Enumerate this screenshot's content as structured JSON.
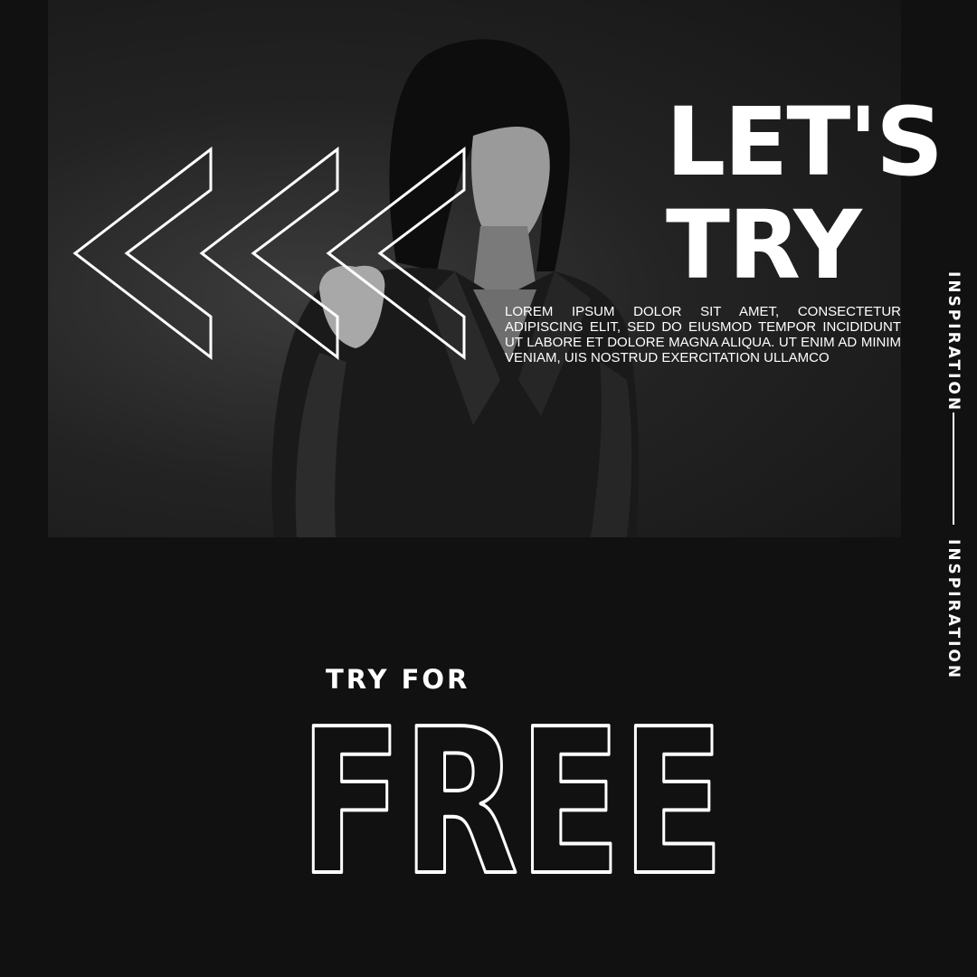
{
  "headline": {
    "line1": "LET'S",
    "line2": "TRY"
  },
  "body": {
    "text": "LOREM IPSUM DOLOR SIT AMET, CONSECTETUR ADIPISCING ELIT, SED DO EIUSMOD TEMPOR INCIDIDUNT UT LABORE ET DOLORE MAGNA ALIQUA. UT ENIM AD MINIM VENIAM, UIS NOSTRUD EXERCITATION ULLAMCO"
  },
  "sidebar": {
    "label_top": "INSPIRATION",
    "label_bottom": "INSPIRATION"
  },
  "cta": {
    "pre": "TRY FOR",
    "main": "FREE"
  },
  "colors": {
    "background": "#111111",
    "text": "#ffffff"
  },
  "icons": {
    "decor": "chevron-left-icon"
  }
}
